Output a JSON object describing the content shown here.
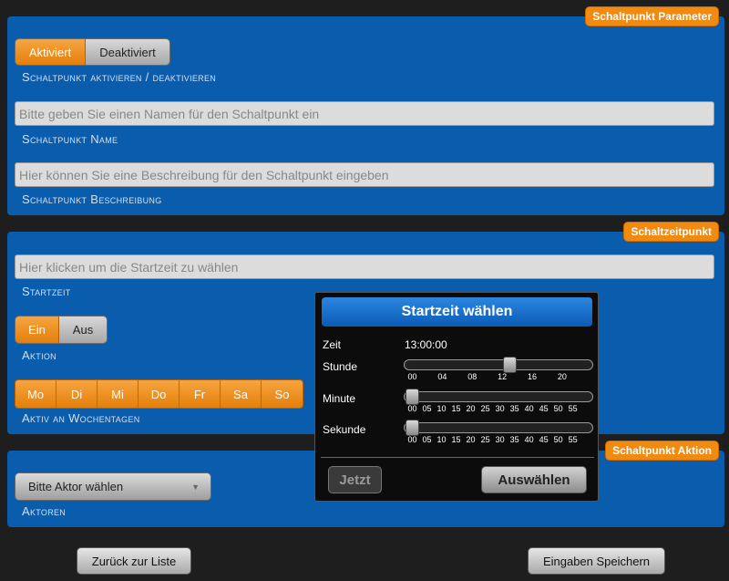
{
  "colors": {
    "panel": "#0a5cad",
    "accent": "#f08a10",
    "background": "#1e1e1e"
  },
  "param_panel": {
    "tag": "Schaltpunkt Parameter",
    "toggle": {
      "on": "Aktiviert",
      "off": "Deaktiviert",
      "selected": "Aktiviert"
    },
    "toggle_label": "Schaltpunkt aktivieren / deaktivieren",
    "name_placeholder": "Bitte geben Sie einen Namen für den Schaltpunkt ein",
    "name_label": "Schaltpunkt Name",
    "desc_placeholder": "Hier können Sie eine Beschreibung für den Schaltpunkt eingeben",
    "desc_label": "Schaltpunkt Beschreibung"
  },
  "time_panel": {
    "tag": "Schaltzeitpunkt",
    "start_placeholder": "Hier klicken um die Startzeit zu wählen",
    "start_label": "Startzeit",
    "action_toggle": {
      "on": "Ein",
      "off": "Aus",
      "selected": "Ein"
    },
    "action_label": "Aktion",
    "days": [
      "Mo",
      "Di",
      "Mi",
      "Do",
      "Fr",
      "Sa",
      "So"
    ],
    "days_label": "Aktiv an Wochentagen"
  },
  "action_panel": {
    "tag": "Schaltpunkt Aktion",
    "select_value": "Bitte Aktor wählen",
    "label": "Aktoren"
  },
  "footer": {
    "back": "Zurück zur Liste",
    "save": "Eingaben Speichern"
  },
  "time_picker": {
    "title": "Startzeit wählen",
    "zeit_label": "Zeit",
    "zeit_value": "13:00:00",
    "hour_label": "Stunde",
    "hour": 13,
    "hour_ticks": [
      "00",
      "04",
      "08",
      "12",
      "16",
      "20"
    ],
    "minute_label": "Minute",
    "minute": 0,
    "minute_ticks": [
      "00",
      "05",
      "10",
      "15",
      "20",
      "25",
      "30",
      "35",
      "40",
      "45",
      "50",
      "55"
    ],
    "second_label": "Sekunde",
    "second": 0,
    "second_ticks": [
      "00",
      "05",
      "10",
      "15",
      "20",
      "25",
      "30",
      "35",
      "40",
      "45",
      "50",
      "55"
    ],
    "now_button": "Jetzt",
    "select_button": "Auswählen"
  }
}
